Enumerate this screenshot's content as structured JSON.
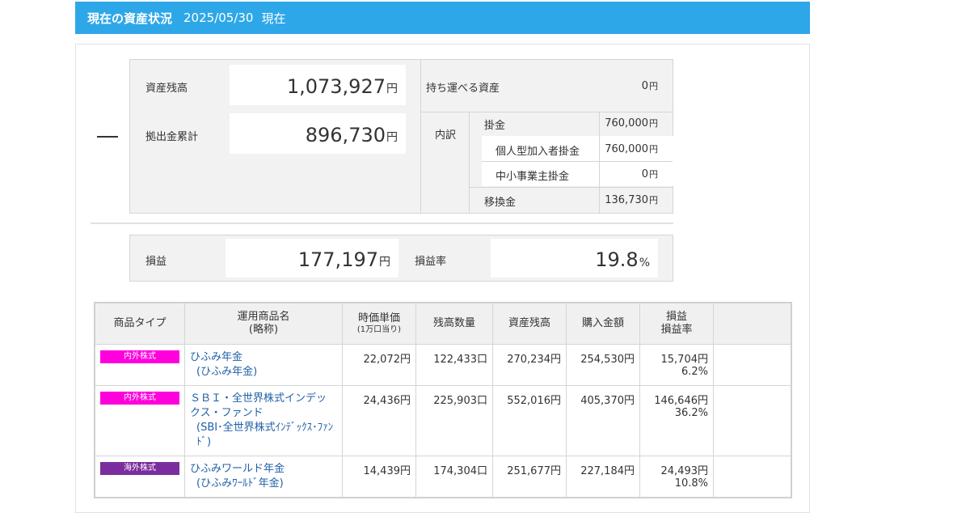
{
  "header": {
    "title": "現在の資産状況",
    "date": "2025/05/30",
    "suffix": "現在"
  },
  "summary": {
    "balance_label": "資産残高",
    "balance_value": "1,073,927",
    "contrib_label": "拠出金累計",
    "contrib_value": "896,730",
    "unit": "円",
    "portable_label": "持ち運べる資産",
    "portable_value": "0",
    "breakdown_label": "内訳",
    "kakekin_label": "掛金",
    "kakekin_value": "760,000",
    "personal_label": "個人型加入者掛金",
    "personal_value": "760,000",
    "employer_label": "中小事業主掛金",
    "employer_value": "0",
    "transfer_label": "移換金",
    "transfer_value": "136,730"
  },
  "pl": {
    "label": "損益",
    "value": "177,197",
    "rate_label": "損益率",
    "rate_value": "19.8",
    "rate_unit": "%"
  },
  "table": {
    "headers": {
      "type": "商品タイプ",
      "name": "運用商品名",
      "name_sub": "(略称)",
      "price": "時価単価",
      "price_sub": "(1万口当り)",
      "qty": "残高数量",
      "balance": "資産残高",
      "cost": "購入金額",
      "pl": "損益",
      "pl_rate": "損益率"
    },
    "rows": [
      {
        "type": "内外株式",
        "type_color": "#ff00dd",
        "name": "ひふみ年金",
        "short": "(ひふみ年金)",
        "price": "22,072円",
        "qty": "122,433口",
        "balance": "270,234円",
        "cost": "254,530円",
        "pl": "15,704円",
        "rate": "6.2%"
      },
      {
        "type": "内外株式",
        "type_color": "#ff00dd",
        "name": "ＳＢＩ・全世界株式インデックス・ファンド",
        "short": "(SBI･全世界株式ｲﾝﾃﾞｯｸｽ･ﾌｧﾝﾄﾞ)",
        "price": "24,436円",
        "qty": "225,903口",
        "balance": "552,016円",
        "cost": "405,370円",
        "pl": "146,646円",
        "rate": "36.2%"
      },
      {
        "type": "海外株式",
        "type_color": "#7a2e9e",
        "name": "ひふみワールド年金",
        "short": "(ひふみﾜｰﾙﾄﾞ年金)",
        "price": "14,439円",
        "qty": "174,304口",
        "balance": "251,677円",
        "cost": "227,184円",
        "pl": "24,493円",
        "rate": "10.8%"
      }
    ]
  }
}
